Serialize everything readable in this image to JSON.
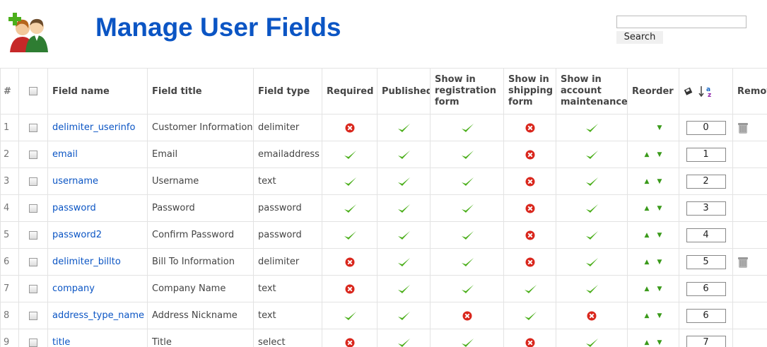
{
  "header": {
    "title": "Manage User Fields",
    "logo_icon": "users-icon"
  },
  "search": {
    "placeholder": "",
    "value": "",
    "button_label": "Search"
  },
  "table": {
    "columns": {
      "num": "#",
      "field_name": "Field name",
      "field_title": "Field title",
      "field_type": "Field type",
      "required": "Required",
      "published": "Published",
      "show_registration": "Show in registration form",
      "show_shipping": "Show in shipping form",
      "show_account": "Show in account maintenance",
      "reorder": "Reorder",
      "remove": "Remov"
    },
    "rows": [
      {
        "num": "1",
        "name": "delimiter_userinfo",
        "title": "Customer Information",
        "type": "delimiter",
        "required": "no",
        "published": "yes",
        "registration": "yes",
        "shipping": "no",
        "account": "yes",
        "up": false,
        "down": true,
        "order": "0",
        "removable": true
      },
      {
        "num": "2",
        "name": "email",
        "title": "Email",
        "type": "emailaddress",
        "required": "yes",
        "published": "yes",
        "registration": "yes",
        "shipping": "no",
        "account": "yes",
        "up": true,
        "down": true,
        "order": "1",
        "removable": false
      },
      {
        "num": "3",
        "name": "username",
        "title": "Username",
        "type": "text",
        "required": "yes",
        "published": "yes",
        "registration": "yes",
        "shipping": "no",
        "account": "yes",
        "up": true,
        "down": true,
        "order": "2",
        "removable": false
      },
      {
        "num": "4",
        "name": "password",
        "title": "Password",
        "type": "password",
        "required": "yes",
        "published": "yes",
        "registration": "yes",
        "shipping": "no",
        "account": "yes",
        "up": true,
        "down": true,
        "order": "3",
        "removable": false
      },
      {
        "num": "5",
        "name": "password2",
        "title": "Confirm Password",
        "type": "password",
        "required": "yes",
        "published": "yes",
        "registration": "yes",
        "shipping": "no",
        "account": "yes",
        "up": true,
        "down": true,
        "order": "4",
        "removable": false
      },
      {
        "num": "6",
        "name": "delimiter_billto",
        "title": "Bill To Information",
        "type": "delimiter",
        "required": "no",
        "published": "yes",
        "registration": "yes",
        "shipping": "no",
        "account": "yes",
        "up": true,
        "down": true,
        "order": "5",
        "removable": true
      },
      {
        "num": "7",
        "name": "company",
        "title": "Company Name",
        "type": "text",
        "required": "no",
        "published": "yes",
        "registration": "yes",
        "shipping": "yes",
        "account": "yes",
        "up": true,
        "down": true,
        "order": "6",
        "removable": false
      },
      {
        "num": "8",
        "name": "address_type_name",
        "title": "Address Nickname",
        "type": "text",
        "required": "yes",
        "published": "yes",
        "registration": "no",
        "shipping": "yes",
        "account": "no",
        "up": true,
        "down": true,
        "order": "6",
        "removable": false
      },
      {
        "num": "9",
        "name": "title",
        "title": "Title",
        "type": "select",
        "required": "no",
        "published": "yes",
        "registration": "yes",
        "shipping": "no",
        "account": "yes",
        "up": true,
        "down": true,
        "order": "7",
        "removable": false
      }
    ]
  },
  "icons": {
    "check": "check-icon",
    "cross": "cross-icon",
    "trash": "trash-icon",
    "up": "arrow-up-icon",
    "down": "arrow-down-icon",
    "save_order": "save-order-icon",
    "sort_az": "sort-az-icon"
  },
  "colors": {
    "title": "#0b55c4",
    "link": "#0b55c4",
    "check": "#4caf1c",
    "cross": "#d9261c"
  }
}
